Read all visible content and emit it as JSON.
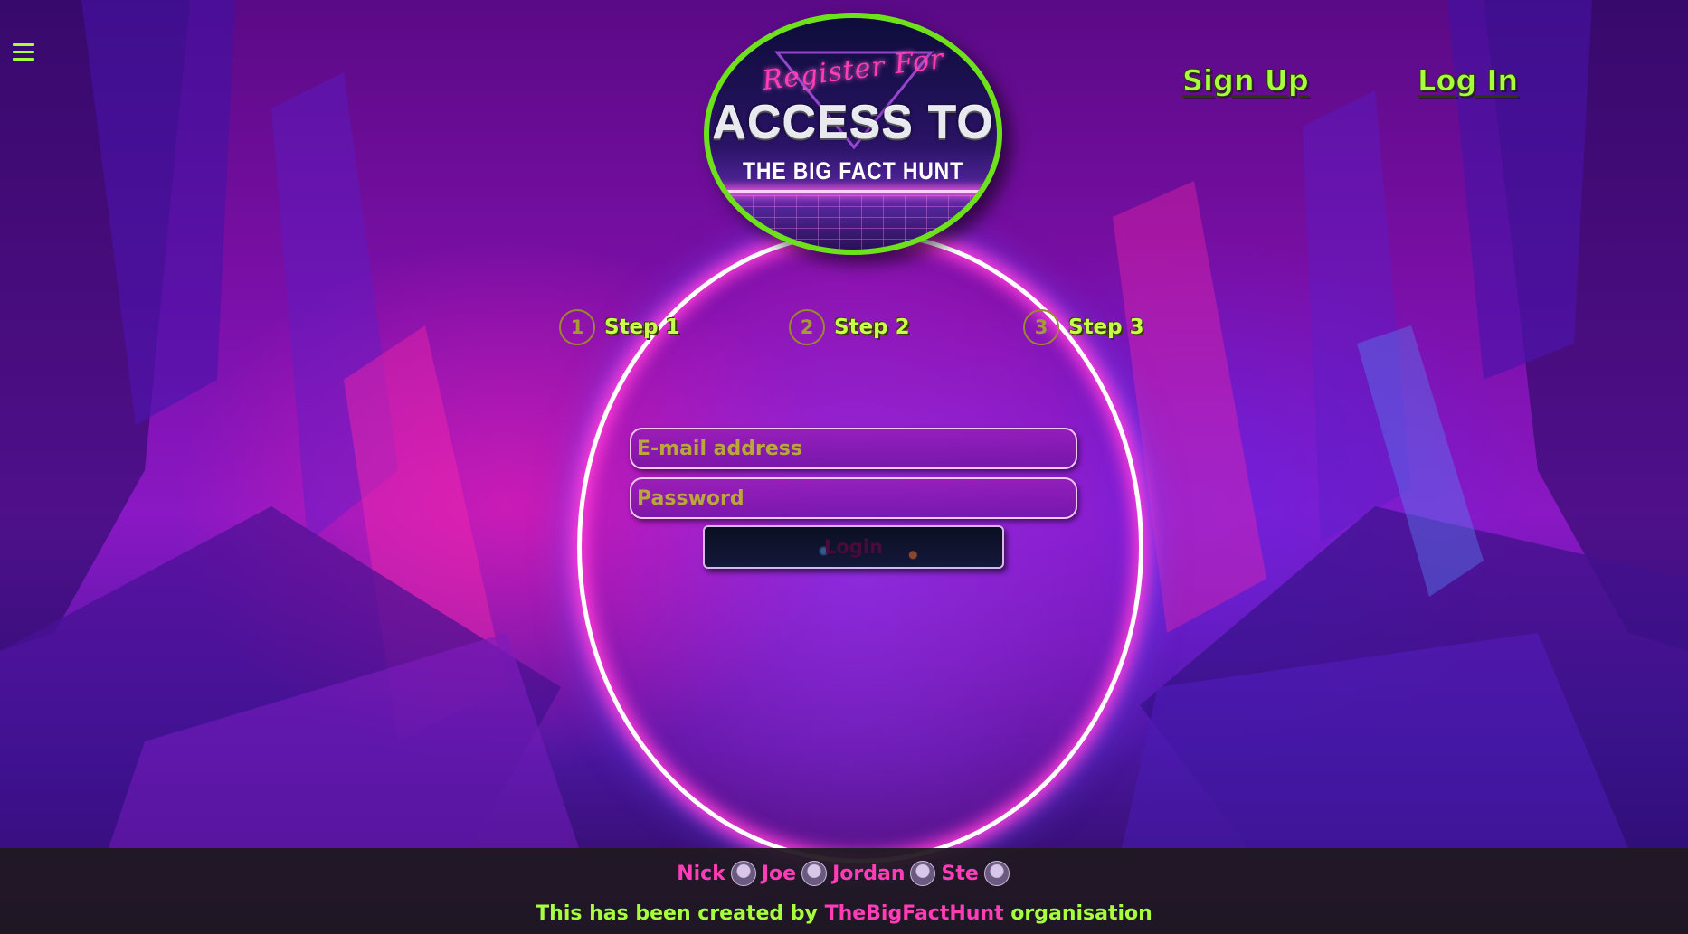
{
  "nav": {
    "menu_icon": "hamburger-icon",
    "signup_label": "Sign Up",
    "login_label": "Log In"
  },
  "logo": {
    "line1": "Register For",
    "line2": "ACCESS TO",
    "line3": "THE BIG FACT HUNT"
  },
  "steps": [
    {
      "number": "1",
      "label": "Step 1"
    },
    {
      "number": "2",
      "label": "Step 2"
    },
    {
      "number": "3",
      "label": "Step 3"
    }
  ],
  "form": {
    "email_placeholder": "E-mail address",
    "password_placeholder": "Password",
    "submit_label": "Login"
  },
  "footer": {
    "authors": [
      "Nick",
      "Joe",
      "Jordan",
      "Ste"
    ],
    "author_icon": "github-icon",
    "credit_prefix": "This has been created by",
    "credit_org": "TheBigFactHunt",
    "credit_suffix": "organisation"
  },
  "colors": {
    "accent_green": "#a8ff3e",
    "accent_pink": "#ff3db6",
    "portal_ring": "#ffffff"
  }
}
